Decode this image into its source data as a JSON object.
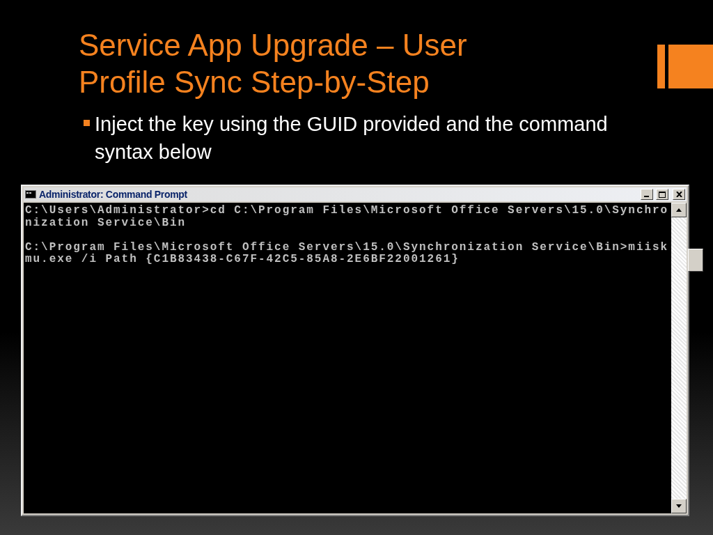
{
  "slide": {
    "title_lines": [
      "Service App Upgrade – User",
      "Profile Sync Step-by-Step"
    ],
    "bullets": [
      "Inject the key using the GUID provided and the command syntax below"
    ]
  },
  "window": {
    "title": "Administrator: Command Prompt",
    "console_blocks": [
      {
        "lines": [
          "C:\\Users\\Administrator>cd C:\\Program Files\\Microsoft Office Servers\\15.0\\Synchro",
          "nization Service\\Bin"
        ]
      },
      {
        "lines": [
          "C:\\Program Files\\Microsoft Office Servers\\15.0\\Synchronization Service\\Bin>miisk",
          "mu.exe /i Path {C1B83438-C67F-42C5-85A8-2E6BF22001261}"
        ]
      }
    ]
  }
}
